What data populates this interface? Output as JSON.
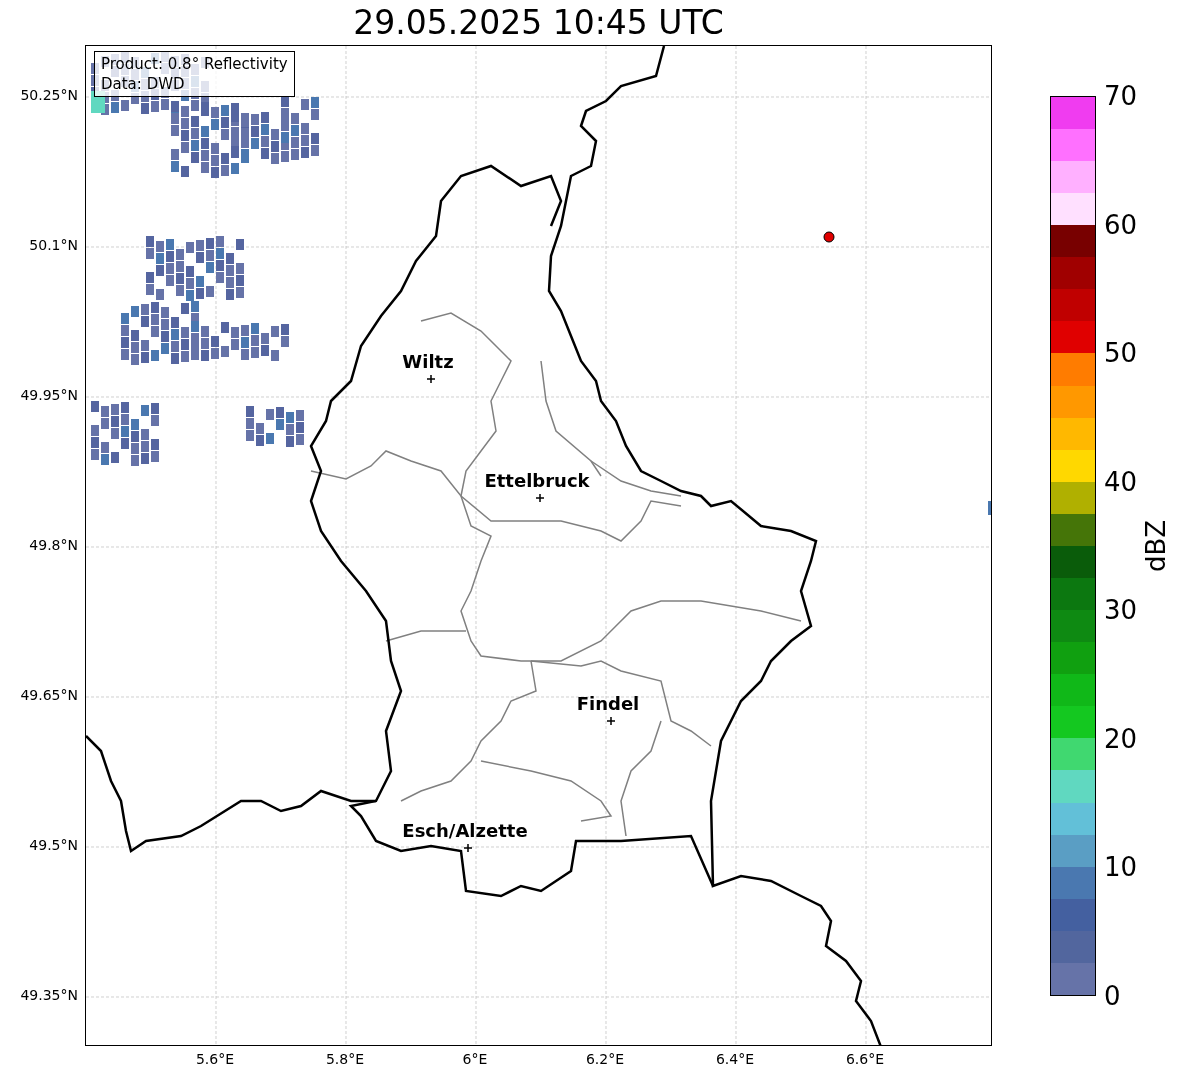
{
  "title": "29.05.2025 10:45 UTC",
  "map": {
    "info_box": [
      "Product: 0.8° Reflectivity",
      "Data: DWD"
    ],
    "lat_ticks": [
      "50.25°N",
      "50.1°N",
      "49.95°N",
      "49.8°N",
      "49.65°N",
      "49.5°N",
      "49.35°N"
    ],
    "lon_ticks": [
      "5.6°E",
      "5.8°E",
      "6°E",
      "6.2°E",
      "6.4°E",
      "6.6°E"
    ],
    "cities": [
      {
        "name": "Wiltz"
      },
      {
        "name": "Ettelbruck"
      },
      {
        "name": "Findel"
      },
      {
        "name": "Esch/Alzette"
      }
    ]
  },
  "colorbar": {
    "label": "dBZ",
    "ticks": [
      "70",
      "60",
      "50",
      "40",
      "30",
      "20",
      "10",
      "0"
    ],
    "bins": [
      {
        "color": "#6673a8"
      },
      {
        "color": "#52669e"
      },
      {
        "color": "#4460a0"
      },
      {
        "color": "#4a78b0"
      },
      {
        "color": "#5a9ec4"
      },
      {
        "color": "#62c0d8"
      },
      {
        "color": "#60d8c0"
      },
      {
        "color": "#40d870"
      },
      {
        "color": "#14c820"
      },
      {
        "color": "#10b818"
      },
      {
        "color": "#10a010"
      },
      {
        "color": "#0e8a12"
      },
      {
        "color": "#0c7810"
      },
      {
        "color": "#0a5c0a"
      },
      {
        "color": "#457508"
      },
      {
        "color": "#b0b000"
      },
      {
        "color": "#ffd800"
      },
      {
        "color": "#ffb800"
      },
      {
        "color": "#ff9800"
      },
      {
        "color": "#ff7c00"
      },
      {
        "color": "#e00000"
      },
      {
        "color": "#c00000"
      },
      {
        "color": "#a00000"
      },
      {
        "color": "#780000"
      },
      {
        "color": "#ffe0ff"
      },
      {
        "color": "#ffb0ff"
      },
      {
        "color": "#ff70ff"
      },
      {
        "color": "#f03cf0"
      }
    ]
  }
}
